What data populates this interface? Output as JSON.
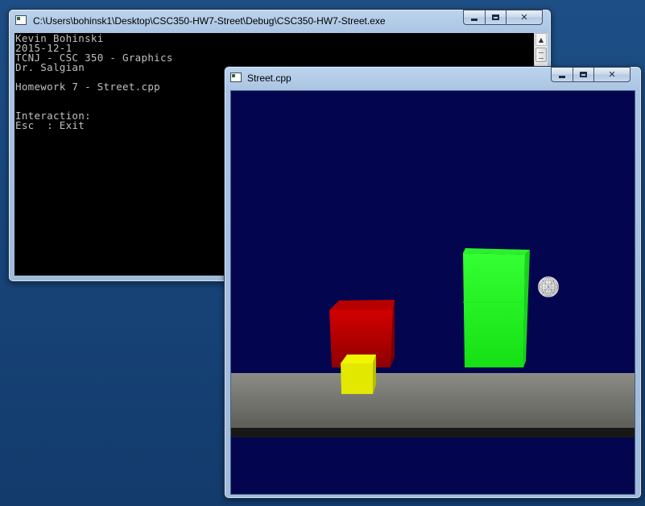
{
  "console_window": {
    "title": "C:\\Users\\bohinsk1\\Desktop\\CSC350-HW7-Street\\Debug\\CSC350-HW7-Street.exe",
    "icon": "console-app-icon",
    "lines": [
      "Kevin Bohinski",
      "2015-12-1",
      "TCNJ - CSC 350 - Graphics",
      "Dr. Salgian",
      "",
      "Homework 7 - Street.cpp",
      "",
      "",
      "Interaction:",
      "Esc  : Exit"
    ]
  },
  "street_window": {
    "title": "Street.cpp",
    "icon": "opengl-window-icon",
    "scene": {
      "background_color": "#03064f",
      "objects": [
        {
          "name": "street-surface",
          "color": "#6f6f69"
        },
        {
          "name": "street-curb",
          "color": "#1a1a1a"
        },
        {
          "name": "red-cube",
          "color": "#c20000"
        },
        {
          "name": "yellow-cube",
          "color": "#e6ec00"
        },
        {
          "name": "green-box",
          "color": "#22ff22"
        },
        {
          "name": "wireframe-sphere",
          "color": "#ffffff"
        }
      ]
    }
  },
  "caption_buttons": {
    "minimize": "minimize-icon",
    "maximize": "maximize-icon",
    "close": "close-icon"
  },
  "desktop_color": "#174377"
}
